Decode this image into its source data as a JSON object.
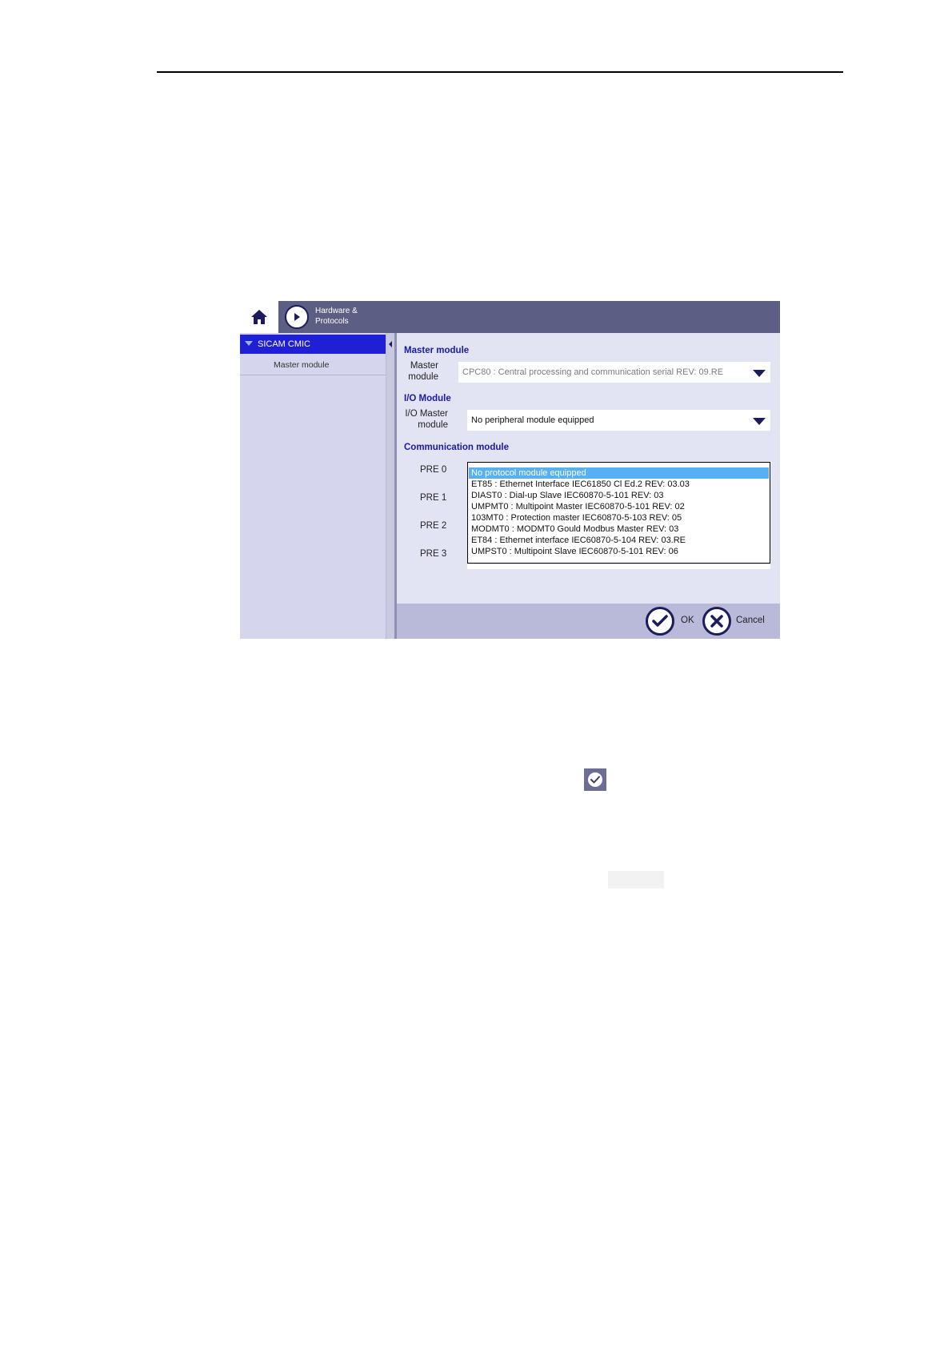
{
  "header": {
    "title": "Hardware & Protocols"
  },
  "sidebar": {
    "root_label": "SICAM CMIC",
    "items": [
      {
        "label": "Master module"
      }
    ]
  },
  "sections": {
    "master": {
      "title": "Master module",
      "field_label": "Master module",
      "value": "CPC80 : Central processing and communication serial REV: 09.RE"
    },
    "io": {
      "title": "I/O Module",
      "field_label": "I/O Master module",
      "value": "No peripheral module equipped"
    },
    "comm": {
      "title": "Communication module",
      "pre_labels": [
        "PRE 0",
        "PRE 1",
        "PRE 2",
        "PRE 3"
      ],
      "options": [
        "No protocol module equipped",
        "ET85 : Ethernet Interface IEC61850 Cl Ed.2 REV: 03.03",
        "DIAST0 : Dial-up Slave IEC60870-5-101 REV: 03",
        "UMPMT0 : Multipoint Master IEC60870-5-101 REV: 02",
        "103MT0 : Protection master IEC60870-5-103 REV: 05",
        "MODMT0 : MODMT0 Gould Modbus Master REV: 03",
        "ET84 : Ethernet interface IEC60870-5-104 REV: 03.RE",
        "UMPST0 : Multipoint Slave IEC60870-5-101 REV: 06"
      ],
      "selected_index": 0
    }
  },
  "footer": {
    "ok_label": "OK",
    "cancel_label": "Cancel"
  },
  "icons": {
    "home": "home-icon",
    "forward": "chevron-right-icon",
    "ok": "checkmark-icon",
    "cancel": "close-icon"
  },
  "colors": {
    "header_bg": "#5d5e83",
    "selection": "#1f1fd6",
    "list_highlight": "#56b0f2",
    "section_title": "#1a1aa8"
  }
}
